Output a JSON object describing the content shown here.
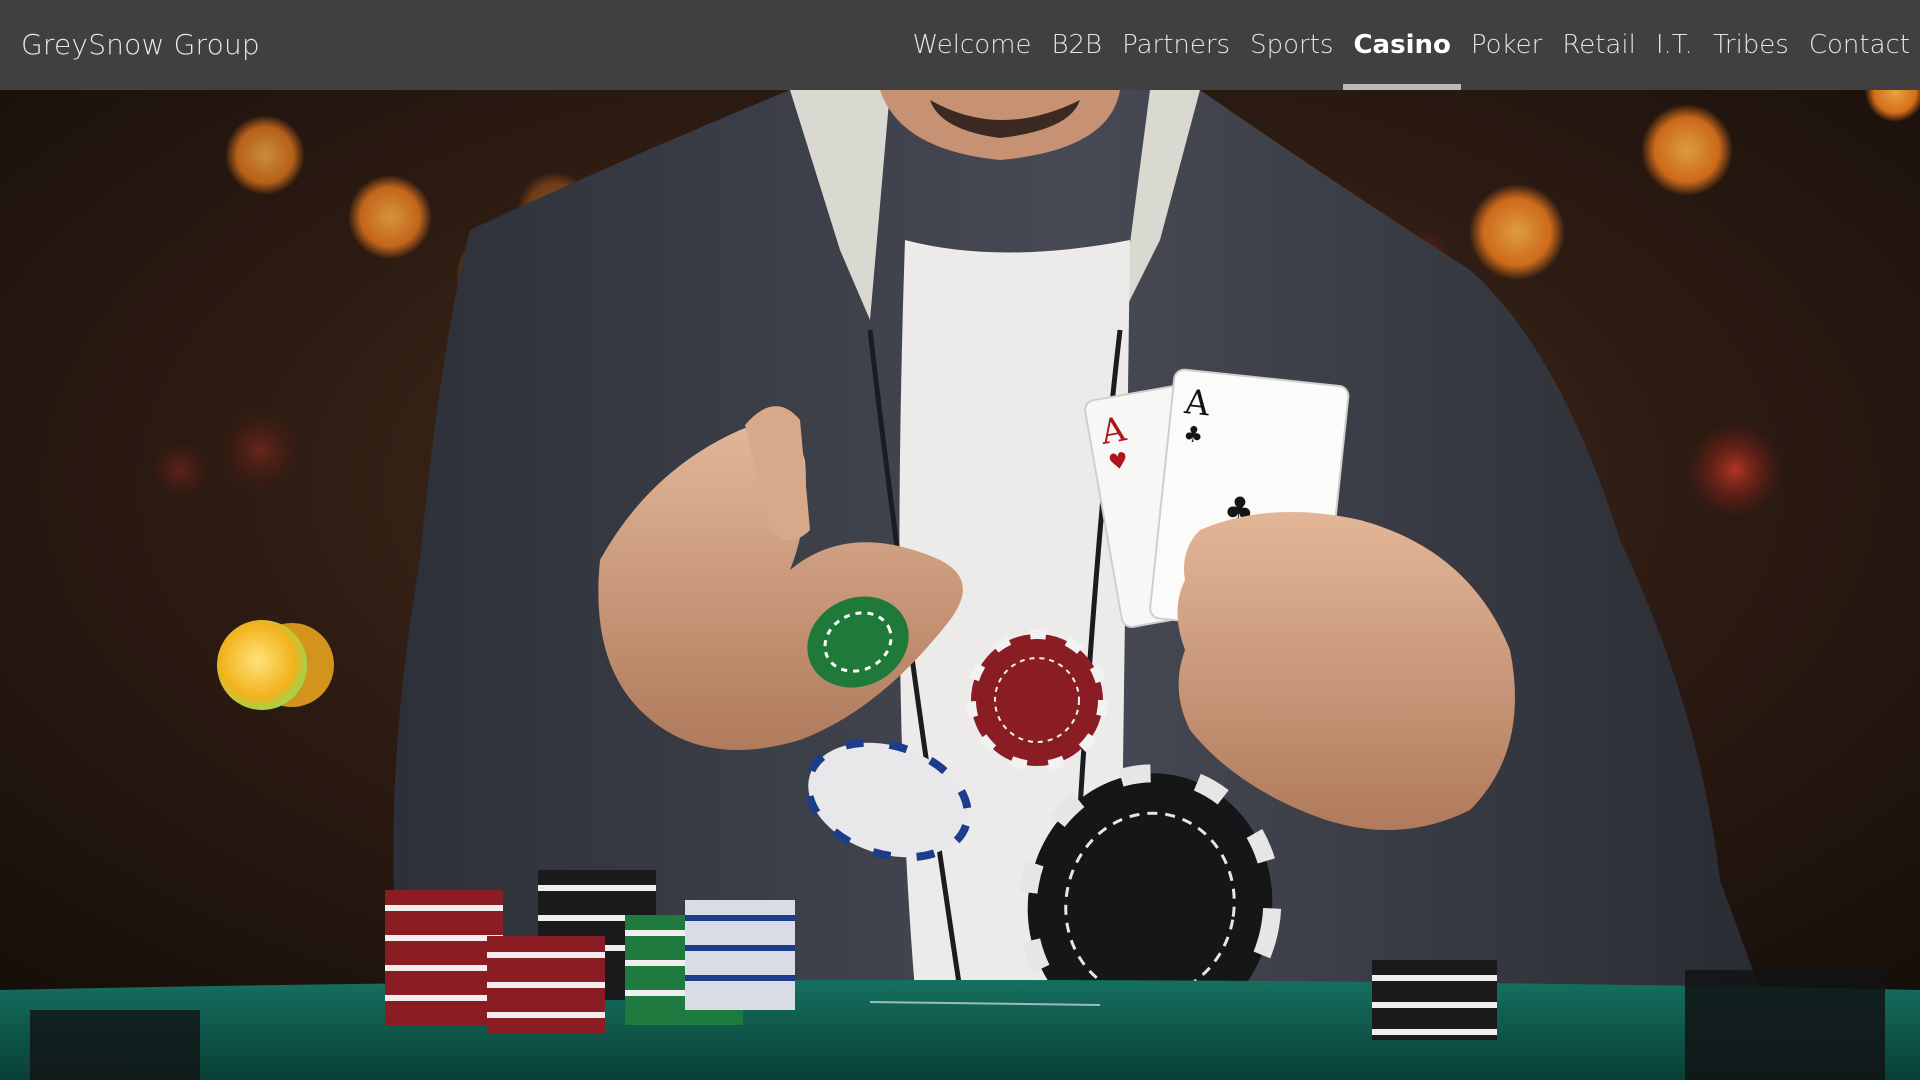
{
  "header": {
    "brand": "GreySnow Group",
    "nav": [
      {
        "label": "Welcome",
        "active": false
      },
      {
        "label": "B2B",
        "active": false
      },
      {
        "label": "Partners",
        "active": false
      },
      {
        "label": "Sports",
        "active": false
      },
      {
        "label": "Casino",
        "active": true
      },
      {
        "label": "Poker",
        "active": false
      },
      {
        "label": "Retail",
        "active": false
      },
      {
        "label": "I.T.",
        "active": false
      },
      {
        "label": "Tribes",
        "active": false
      },
      {
        "label": "Contact",
        "active": false
      }
    ]
  },
  "hero": {
    "card_ranks": [
      "A",
      "A"
    ],
    "colors": {
      "header_bg": "#404040",
      "active_underline": "#b9b9b9",
      "felt": "#0f5a4c",
      "hoodie": "#3a3d45"
    }
  }
}
